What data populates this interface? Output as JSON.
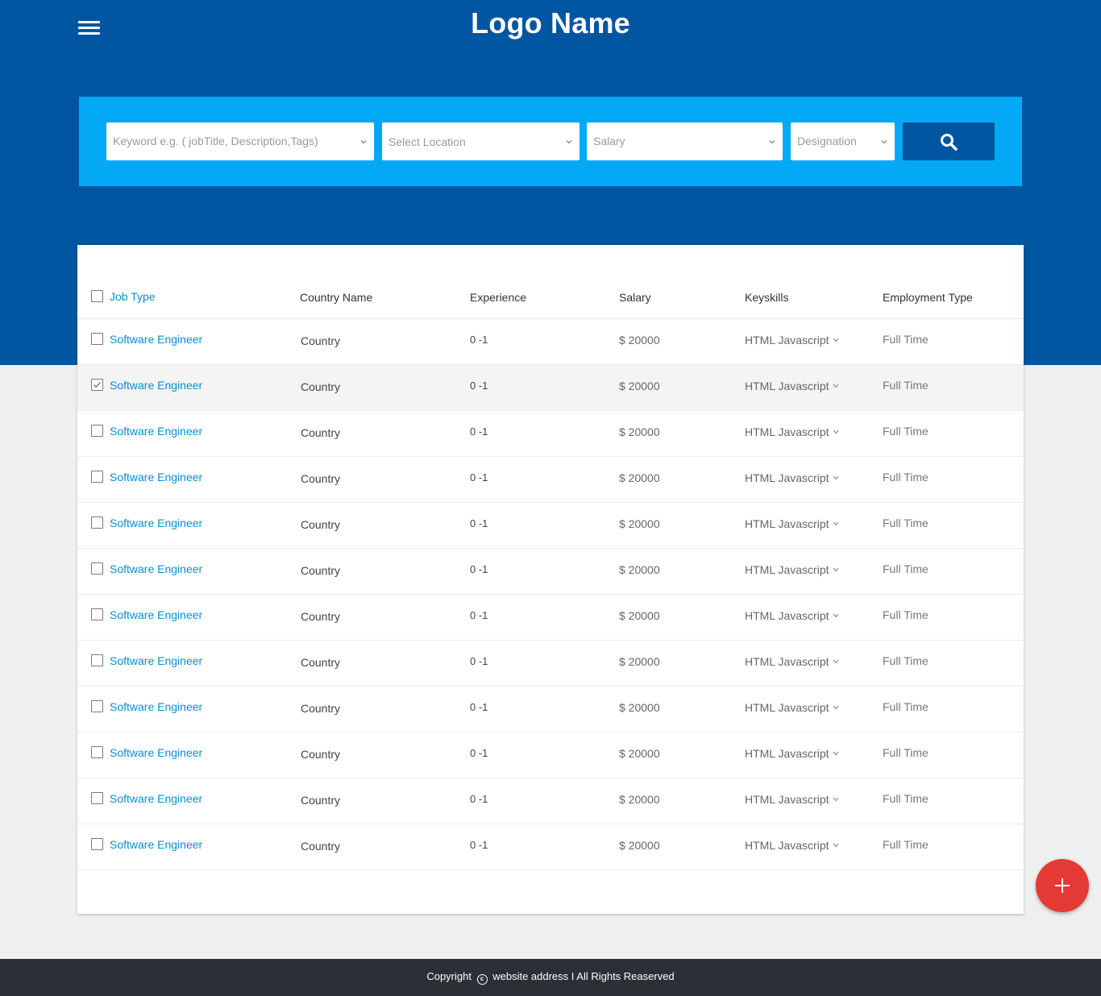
{
  "header": {
    "logo": "Logo Name",
    "menu_icon": "hamburger-icon"
  },
  "search": {
    "keyword_placeholder": "Keyword e.g. ( jobTitle, Description,Tags)",
    "location_placeholder": "Select Location",
    "salary_placeholder": "Salary",
    "designation_placeholder": "Designation",
    "button_icon": "search-icon"
  },
  "table": {
    "columns": [
      "Job Type",
      "Country Name",
      "Experience",
      "Salary",
      "Keyskills",
      "Employment Type"
    ],
    "rows": [
      {
        "job_type": "Software Engineer",
        "country": "Country",
        "experience": "0 -1",
        "salary": "$ 20000",
        "keyskills": "HTML Javascript",
        "employment": "Full Time",
        "checked": false
      },
      {
        "job_type": "Software Engineer",
        "country": "Country",
        "experience": "0 -1",
        "salary": "$ 20000",
        "keyskills": "HTML Javascript",
        "employment": "Full Time",
        "checked": true
      },
      {
        "job_type": "Software Engineer",
        "country": "Country",
        "experience": "0 -1",
        "salary": "$ 20000",
        "keyskills": "HTML Javascript",
        "employment": "Full Time",
        "checked": false
      },
      {
        "job_type": "Software Engineer",
        "country": "Country",
        "experience": "0 -1",
        "salary": "$ 20000",
        "keyskills": "HTML Javascript",
        "employment": "Full Time",
        "checked": false
      },
      {
        "job_type": "Software Engineer",
        "country": "Country",
        "experience": "0 -1",
        "salary": "$ 20000",
        "keyskills": "HTML Javascript",
        "employment": "Full Time",
        "checked": false
      },
      {
        "job_type": "Software Engineer",
        "country": "Country",
        "experience": "0 -1",
        "salary": "$ 20000",
        "keyskills": "HTML Javascript",
        "employment": "Full Time",
        "checked": false
      },
      {
        "job_type": "Software Engineer",
        "country": "Country",
        "experience": "0 -1",
        "salary": "$ 20000",
        "keyskills": "HTML Javascript",
        "employment": "Full Time",
        "checked": false
      },
      {
        "job_type": "Software Engineer",
        "country": "Country",
        "experience": "0 -1",
        "salary": "$ 20000",
        "keyskills": "HTML Javascript",
        "employment": "Full Time",
        "checked": false
      },
      {
        "job_type": "Software Engineer",
        "country": "Country",
        "experience": "0 -1",
        "salary": "$ 20000",
        "keyskills": "HTML Javascript",
        "employment": "Full Time",
        "checked": false
      },
      {
        "job_type": "Software Engineer",
        "country": "Country",
        "experience": "0 -1",
        "salary": "$ 20000",
        "keyskills": "HTML Javascript",
        "employment": "Full Time",
        "checked": false
      },
      {
        "job_type": "Software Engineer",
        "country": "Country",
        "experience": "0 -1",
        "salary": "$ 20000",
        "keyskills": "HTML Javascript",
        "employment": "Full Time",
        "checked": false
      },
      {
        "job_type": "Software Engineer",
        "country": "Country",
        "experience": "0 -1",
        "salary": "$ 20000",
        "keyskills": "HTML Javascript",
        "employment": "Full Time",
        "checked": false
      }
    ]
  },
  "fab": {
    "icon": "plus-icon"
  },
  "footer": {
    "before": "Copyright",
    "symbol": "c",
    "after": "website address I All Rights Reaserved"
  },
  "colors": {
    "header_bg": "#0056a0",
    "search_bg": "#03a9f4",
    "link": "#0a8ed3",
    "fab": "#e53935",
    "footer_bg": "#2c2f35"
  }
}
